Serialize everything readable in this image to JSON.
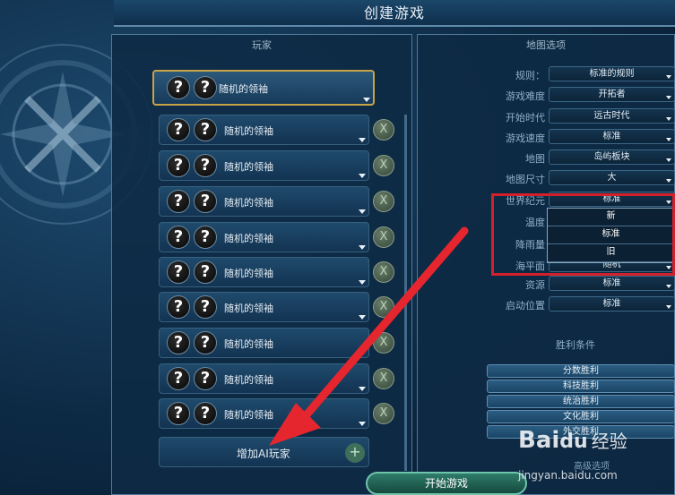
{
  "title": "创建游戏",
  "players_panel": {
    "header": "玩家",
    "host": {
      "leader_label": "随机的领袖",
      "avatar_glyph": "?"
    },
    "players": [
      {
        "leader_label": "随机的领袖",
        "remove_glyph": "X"
      },
      {
        "leader_label": "随机的领袖",
        "remove_glyph": "X"
      },
      {
        "leader_label": "随机的领袖",
        "remove_glyph": "X"
      },
      {
        "leader_label": "随机的领袖",
        "remove_glyph": "X"
      },
      {
        "leader_label": "随机的领袖",
        "remove_glyph": "X"
      },
      {
        "leader_label": "随机的领袖",
        "remove_glyph": "X"
      },
      {
        "leader_label": "随机的领袖",
        "remove_glyph": "X"
      },
      {
        "leader_label": "随机的领袖",
        "remove_glyph": "X"
      },
      {
        "leader_label": "随机的领袖",
        "remove_glyph": "X"
      }
    ],
    "add_ai_label": "增加AI玩家",
    "add_ai_plus": "+"
  },
  "map_options": {
    "header": "地图选项",
    "rows": [
      {
        "label": "规则：",
        "value": "标准的规则"
      },
      {
        "label": "游戏难度",
        "value": "开拓者"
      },
      {
        "label": "开始时代",
        "value": "远古时代"
      },
      {
        "label": "游戏速度",
        "value": "标准"
      },
      {
        "label": "地图",
        "value": "岛屿板块"
      },
      {
        "label": "地图尺寸",
        "value": "大"
      },
      {
        "label": "世界纪元",
        "value": "标准"
      },
      {
        "label": "温度",
        "value": ""
      },
      {
        "label": "降雨量",
        "value": ""
      },
      {
        "label": "海平面",
        "value": "随机"
      },
      {
        "label": "资源",
        "value": "标准"
      },
      {
        "label": "启动位置",
        "value": "标准"
      }
    ],
    "open_dropdown_options": [
      "新",
      "标准",
      "旧"
    ]
  },
  "victory": {
    "header": "胜利条件",
    "items": [
      "分数胜利",
      "科技胜利",
      "统治胜利",
      "文化胜利",
      "外交胜利"
    ],
    "more_label": "高级选项"
  },
  "start_button_label": "开始游戏",
  "watermark": {
    "logo": "Bai",
    "logo_suffix": "du",
    "jy": "经验",
    "url": "jingyan.baidu.com"
  },
  "colors": {
    "accent_gold": "#c8a347",
    "highlight_red": "#d4202a",
    "arrow_red": "#e5262e"
  }
}
